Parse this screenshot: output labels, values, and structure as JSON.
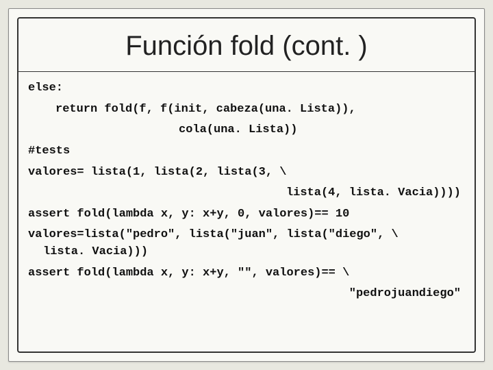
{
  "slide": {
    "title": "Función fold (cont. )",
    "code": {
      "l1": "else:",
      "l2": "return fold(f, f(init, cabeza(una. Lista)),",
      "l3": "cola(una. Lista))",
      "l4": "#tests",
      "l5": "valores= lista(1, lista(2, lista(3, \\",
      "l6": "lista(4, lista. Vacia))))",
      "l7": "assert fold(lambda x, y: x+y, 0, valores)== 10",
      "l8a": "valores=lista(\"pedro\", lista(\"juan\", lista(\"diego\", \\",
      "l8b": "lista. Vacia)))",
      "l9": "assert fold(lambda x, y: x+y, \"\", valores)== \\",
      "l10": "\"pedrojuandiego\""
    }
  }
}
